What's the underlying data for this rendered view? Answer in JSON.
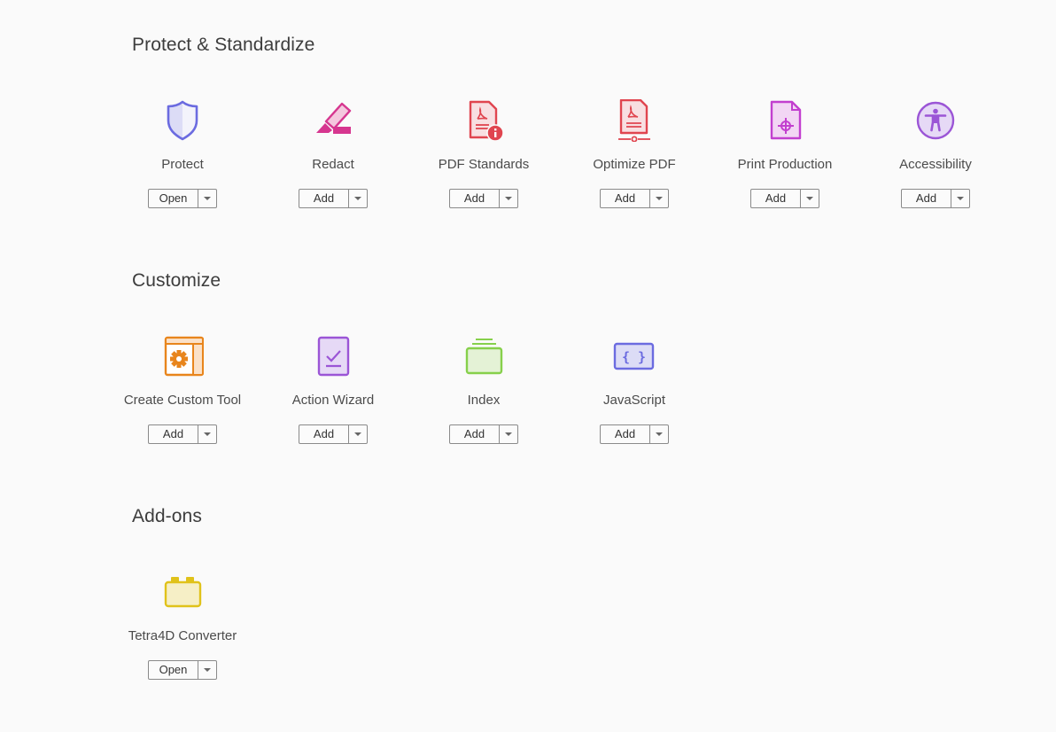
{
  "sections": [
    {
      "title": "Protect & Standardize",
      "tools": [
        {
          "name": "Protect",
          "icon": "shield-icon",
          "action": "Open"
        },
        {
          "name": "Redact",
          "icon": "redact-marker-icon",
          "action": "Add"
        },
        {
          "name": "PDF Standards",
          "icon": "pdf-standards-icon",
          "action": "Add"
        },
        {
          "name": "Optimize PDF",
          "icon": "optimize-pdf-icon",
          "action": "Add"
        },
        {
          "name": "Print Production",
          "icon": "print-production-icon",
          "action": "Add"
        },
        {
          "name": "Accessibility",
          "icon": "accessibility-icon",
          "action": "Add"
        }
      ]
    },
    {
      "title": "Customize",
      "tools": [
        {
          "name": "Create Custom Tool",
          "icon": "custom-tool-gear-icon",
          "action": "Add"
        },
        {
          "name": "Action Wizard",
          "icon": "action-wizard-icon",
          "action": "Add"
        },
        {
          "name": "Index",
          "icon": "index-icon",
          "action": "Add"
        },
        {
          "name": "JavaScript",
          "icon": "javascript-braces-icon",
          "action": "Add"
        }
      ]
    },
    {
      "title": "Add-ons",
      "tools": [
        {
          "name": "Tetra4D Converter",
          "icon": "tetra4d-block-icon",
          "action": "Open"
        }
      ]
    }
  ],
  "colors": {
    "protect": "#6b6be0",
    "redact": "#d6368f",
    "pdf": "#e0454f",
    "print": "#c23fcf",
    "accessibility": "#9b55d6",
    "custom": "#e8851c",
    "wizard": "#9b55d6",
    "index": "#86d04b",
    "javascript": "#6b6be0",
    "tetra": "#e0c21a"
  }
}
